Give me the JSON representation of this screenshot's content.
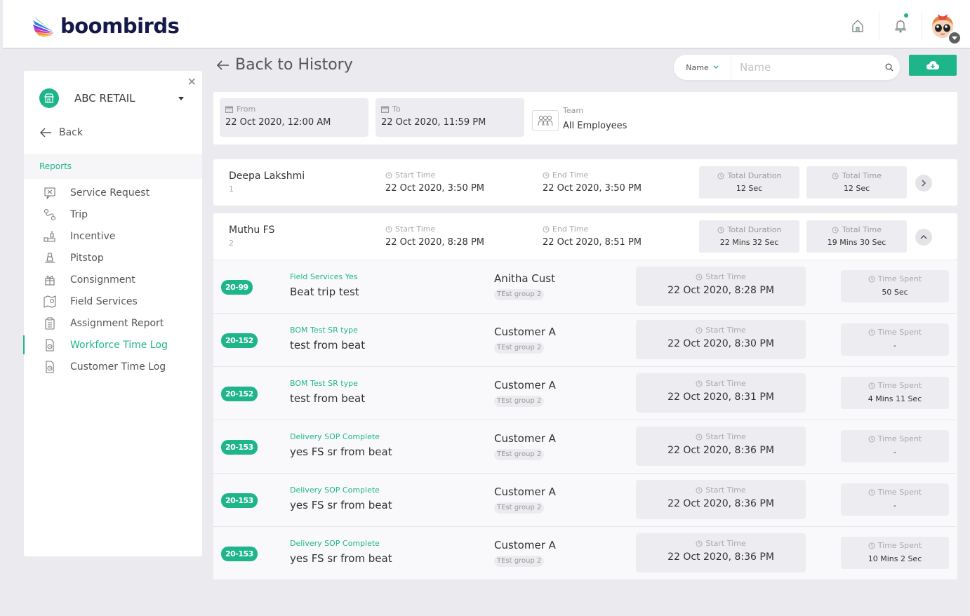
{
  "app": {
    "brand": "boombirds",
    "accent_color": "#1fb58a"
  },
  "header": {
    "icons": [
      "home-icon",
      "bell-icon",
      "avatar"
    ],
    "notification_dot": true
  },
  "sidebar": {
    "org_name": "ABC RETAIL",
    "back_label": "Back",
    "section_title": "Reports",
    "items": [
      {
        "label": "Service Request",
        "icon": "service-request-icon",
        "active": false
      },
      {
        "label": "Trip",
        "icon": "trip-icon",
        "active": false
      },
      {
        "label": "Incentive",
        "icon": "incentive-icon",
        "active": false
      },
      {
        "label": "Pitstop",
        "icon": "pitstop-icon",
        "active": false
      },
      {
        "label": "Consignment",
        "icon": "consignment-icon",
        "active": false
      },
      {
        "label": "Field Services",
        "icon": "field-services-icon",
        "active": false
      },
      {
        "label": "Assignment Report",
        "icon": "assignment-report-icon",
        "active": false
      },
      {
        "label": "Workforce Time Log",
        "icon": "workforce-time-log-icon",
        "active": true
      },
      {
        "label": "Customer Time Log",
        "icon": "customer-time-log-icon",
        "active": false
      }
    ]
  },
  "main": {
    "back_label": "Back to History",
    "search": {
      "select_value": "Name",
      "placeholder": "Name",
      "value": ""
    },
    "filters": {
      "from_label": "From",
      "from_value": "22 Oct 2020, 12:00 AM",
      "to_label": "To",
      "to_value": "22 Oct 2020, 11:59 PM",
      "team_label": "Team",
      "team_value": "All Employees"
    },
    "employees": [
      {
        "name": "Deepa Lakshmi",
        "index": "1",
        "start_label": "Start Time",
        "start_value": "22 Oct 2020, 3:50 PM",
        "end_label": "End Time",
        "end_value": "22 Oct 2020, 3:50 PM",
        "duration_label": "Total Duration",
        "duration_value": "12 Sec",
        "total_label": "Total Time",
        "total_value": "12 Sec",
        "expanded": false
      },
      {
        "name": "Muthu FS",
        "index": "2",
        "start_label": "Start Time",
        "start_value": "22 Oct 2020, 8:28 PM",
        "end_label": "End Time",
        "end_value": "22 Oct 2020, 8:51 PM",
        "duration_label": "Total Duration",
        "duration_value": "22 Mins 32 Sec",
        "total_label": "Total Time",
        "total_value": "19 Mins 30 Sec",
        "expanded": true
      }
    ],
    "tasks": [
      {
        "badge": "20-99",
        "type": "Field Services Yes",
        "title": "Beat trip test",
        "customer": "Anitha Cust",
        "group": "TEst group 2",
        "start_label": "Start Time",
        "start_value": "22 Oct 2020, 8:28 PM",
        "spent_label": "Time Spent",
        "spent_value": "50 Sec"
      },
      {
        "badge": "20-152",
        "type": "BOM Test SR type",
        "title": "test from beat",
        "customer": "Customer A",
        "group": "TEst group 2",
        "start_label": "Start Time",
        "start_value": "22 Oct 2020, 8:30 PM",
        "spent_label": "Time Spent",
        "spent_value": "-"
      },
      {
        "badge": "20-152",
        "type": "BOM Test SR type",
        "title": "test from beat",
        "customer": "Customer A",
        "group": "TEst group 2",
        "start_label": "Start Time",
        "start_value": "22 Oct 2020, 8:31 PM",
        "spent_label": "Time Spent",
        "spent_value": "4 Mins 11 Sec"
      },
      {
        "badge": "20-153",
        "type": "Delivery SOP Complete",
        "title": "yes FS sr from beat",
        "customer": "Customer A",
        "group": "TEst group 2",
        "start_label": "Start Time",
        "start_value": "22 Oct 2020, 8:36 PM",
        "spent_label": "Time Spent",
        "spent_value": "-"
      },
      {
        "badge": "20-153",
        "type": "Delivery SOP Complete",
        "title": "yes FS sr from beat",
        "customer": "Customer A",
        "group": "TEst group 2",
        "start_label": "Start Time",
        "start_value": "22 Oct 2020, 8:36 PM",
        "spent_label": "Time Spent",
        "spent_value": "-"
      },
      {
        "badge": "20-153",
        "type": "Delivery SOP Complete",
        "title": "yes FS sr from beat",
        "customer": "Customer A",
        "group": "TEst group 2",
        "start_label": "Start Time",
        "start_value": "22 Oct 2020, 8:36 PM",
        "spent_label": "Time Spent",
        "spent_value": "10 Mins 2 Sec"
      }
    ]
  }
}
